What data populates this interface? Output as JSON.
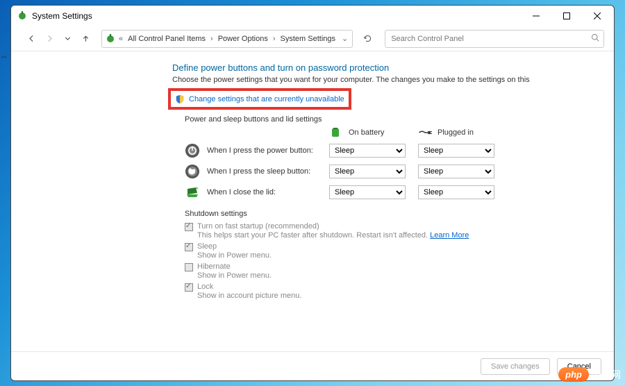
{
  "window": {
    "title": "System Settings"
  },
  "breadcrumb": {
    "prefix": "«",
    "items": [
      "All Control Panel Items",
      "Power Options",
      "System Settings"
    ]
  },
  "search": {
    "placeholder": "Search Control Panel"
  },
  "page": {
    "title": "Define power buttons and turn on password protection",
    "description": "Choose the power settings that you want for your computer. The changes you make to the settings on this",
    "change_link": "Change settings that are currently unavailable",
    "section_buttons": "Power and sleep buttons and lid settings",
    "col_battery": "On battery",
    "col_plugged": "Plugged in",
    "rows": [
      {
        "label": "When I press the power button:",
        "battery": "Sleep",
        "plugged": "Sleep"
      },
      {
        "label": "When I press the sleep button:",
        "battery": "Sleep",
        "plugged": "Sleep"
      },
      {
        "label": "When I close the lid:",
        "battery": "Sleep",
        "plugged": "Sleep"
      }
    ],
    "shutdown_header": "Shutdown settings",
    "shutdown": [
      {
        "title": "Turn on fast startup (recommended)",
        "sub": "This helps start your PC faster after shutdown. Restart isn't affected. ",
        "link": "Learn More",
        "checked": true
      },
      {
        "title": "Sleep",
        "sub": "Show in Power menu.",
        "checked": true
      },
      {
        "title": "Hibernate",
        "sub": "Show in Power menu.",
        "checked": false
      },
      {
        "title": "Lock",
        "sub": "Show in account picture menu.",
        "checked": true
      }
    ]
  },
  "footer": {
    "save": "Save changes",
    "cancel": "Cancel"
  },
  "watermark": {
    "badge": "php",
    "text": "中文网"
  }
}
